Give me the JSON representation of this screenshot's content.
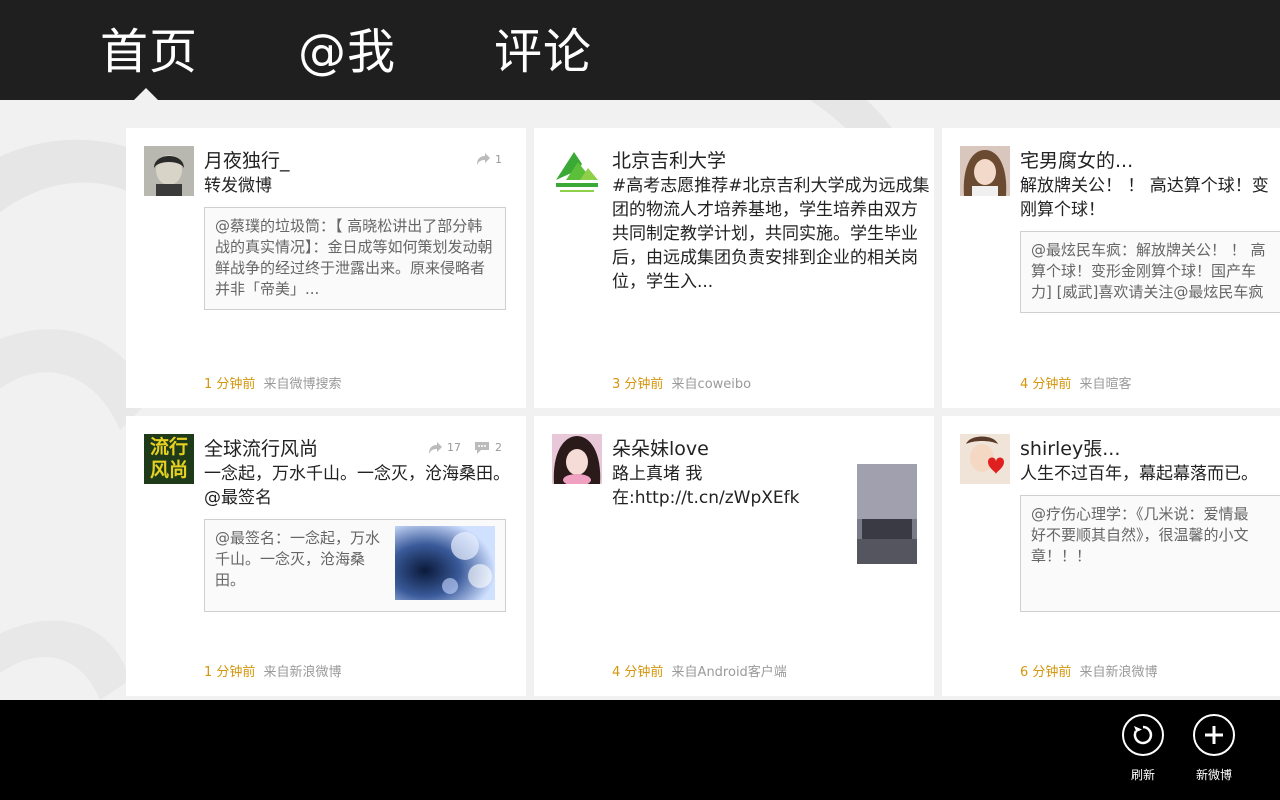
{
  "nav": {
    "tabs": [
      {
        "label": "首页",
        "selected": true
      },
      {
        "label": "@我",
        "selected": false
      },
      {
        "label": "评论",
        "selected": false
      }
    ]
  },
  "colors": {
    "topbar": "#1f1f1f",
    "appbar": "#000000",
    "time": "#d4960a",
    "source": "#9a9a9a"
  },
  "posts": [
    {
      "name": "月夜独行_",
      "text": "转发微博",
      "quote": "@蔡璞的垃圾筒：【 高晓松讲出了部分韩战的真实情况】：金日成等如何策划发动朝鲜战争的经过终于泄露出来。原来侵略者并非「帝美」...",
      "time": "1 分钟前",
      "source": "来自微博搜索",
      "reposts": "1",
      "comments": "",
      "avatar_icon": "portrait-photo"
    },
    {
      "name": "北京吉利大学",
      "text": "#高考志愿推荐#北京吉利大学成为远成集团的物流人才培养基地，学生培养由双方共同制定教学计划，共同实施。学生毕业后，由远成集团负责安排到企业的相关岗位，学生入...",
      "time": "3 分钟前",
      "source": "来自coweibo",
      "avatar_icon": "university-logo"
    },
    {
      "name": "宅男腐女的...",
      "text": "解放牌关公！ ！ 高达算个球！变刚算个球！",
      "quote": "@最炫民车疯：解放牌关公！ ！ 高算个球！变形金刚算个球！国产车力] [威武]喜欢请关注@最炫民车疯",
      "time": "4 分钟前",
      "source": "来自暄客",
      "avatar_icon": "girl-photo"
    },
    {
      "name": "全球流行风尚",
      "text": "一念起，万水千山。一念灭，沧海桑田。@最签名",
      "quote": "@最签名：一念起，万水千山。一念灭，沧海桑田。",
      "time": "1 分钟前",
      "source": "来自新浪微博",
      "reposts": "17",
      "comments": "2",
      "avatar_text": [
        "流行",
        "风尚"
      ]
    },
    {
      "name": "朵朵妹love",
      "text": "路上真堵 我在:http://t.cn/zWpXEfk",
      "time": "4 分钟前",
      "source": "来自Android客户端",
      "avatar_icon": "girl-photo"
    },
    {
      "name": "shirley張...",
      "text": "人生不过百年，幕起幕落而已。",
      "quote": "@疗伤心理学：《几米说：爱情最好不要顺其自然》，很温馨的小文章！！！",
      "time": "6 分钟前",
      "source": "来自新浪微博",
      "avatar_icon": "heart-photo"
    }
  ],
  "appbar": {
    "refresh_label": "刷新",
    "new_post_label": "新微博"
  }
}
